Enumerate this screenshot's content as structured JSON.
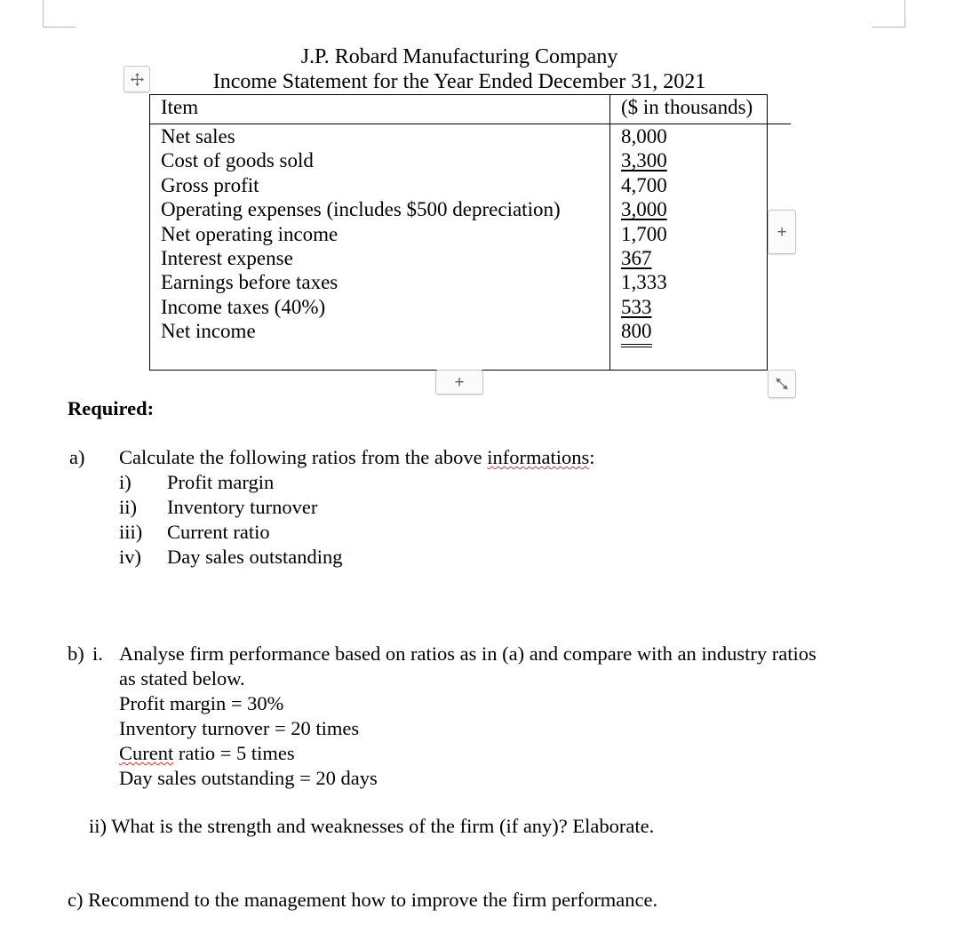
{
  "document": {
    "title_line1": "J.P. Robard Manufacturing Company",
    "title_line2": "Income Statement for the Year Ended December 31, 2021",
    "misspelled_word_title": "Robard"
  },
  "table": {
    "headers": [
      "Item",
      "($ in thousands)"
    ],
    "rows": [
      {
        "item": "Net sales",
        "value": "8,000",
        "style": "plain"
      },
      {
        "item": "Cost of goods sold",
        "value": "3,300",
        "style": "underline"
      },
      {
        "item": "Gross profit",
        "value": "4,700",
        "style": "plain"
      },
      {
        "item": "Operating expenses (includes $500 depreciation)",
        "value": "3,000",
        "style": "underline"
      },
      {
        "item": "Net operating income",
        "value": "1,700",
        "style": "plain"
      },
      {
        "item": "Interest expense",
        "value": "367",
        "style": "underline"
      },
      {
        "item": "Earnings before taxes",
        "value": "1,333",
        "style": "plain"
      },
      {
        "item": "Income taxes (40%)",
        "value": "533",
        "style": "underline"
      },
      {
        "item": "Net income",
        "value": "800",
        "style": "double-underline"
      }
    ]
  },
  "table_handles": {
    "move_handle": "table-move-handle",
    "insert_column_label": "+",
    "insert_row_label": "+",
    "resize_handle": "table-resize-handle"
  },
  "required": {
    "heading": "Required:"
  },
  "part_a": {
    "marker": "a)",
    "text": "Calculate the following ratios from the above informations:",
    "text_before_misspelling": "Calculate the following ratios from the above ",
    "misspelled_word": "informations",
    "text_after_misspelling": ":",
    "items": [
      {
        "marker": "i)",
        "label": "Profit margin"
      },
      {
        "marker": "ii)",
        "label": "Inventory turnover"
      },
      {
        "marker": "iii)",
        "label": "Current ratio"
      },
      {
        "marker": "iv)",
        "label": "Day sales outstanding"
      }
    ]
  },
  "part_b": {
    "marker": "b)",
    "sub_marker_i": "i.",
    "line1": "Analyse firm performance based on ratios as in (a) and compare with an industry ratios",
    "line2": "as stated below.",
    "industry_ratios": [
      {
        "full": "Profit margin = 30%",
        "name": "Profit margin",
        "value": "= 30%"
      },
      {
        "full": "Inventory turnover = 20 times",
        "name": "Inventory turnover",
        "value": "= 20 times"
      },
      {
        "full": "Curent ratio = 5 times",
        "name": "Curent",
        "rest": " ratio = 5 times",
        "misspelled": true
      },
      {
        "full": "Day sales outstanding = 20 days",
        "name": "Day sales outstanding",
        "value": "= 20 days"
      }
    ],
    "sub_ii": "ii) What is the strength and weaknesses of the firm (if any)? Elaborate."
  },
  "part_c": {
    "text": "c) Recommend to the management how to improve the firm performance."
  },
  "colors": {
    "text": "#000000",
    "spellcheck_underline": "#e03030",
    "table_border": "#000000",
    "handle_border": "#c6c6c6",
    "margin_marker": "#b9b9b9"
  }
}
